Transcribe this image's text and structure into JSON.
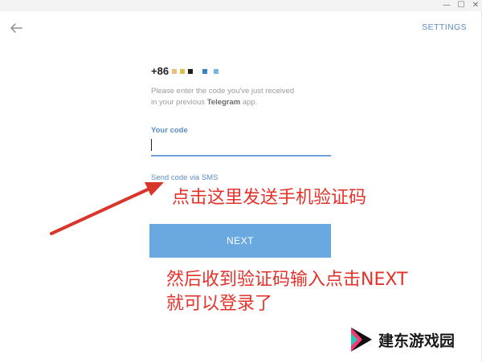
{
  "window": {
    "controls": {
      "minimize": "—",
      "maximize": "☐",
      "close": "✕"
    }
  },
  "header": {
    "back_icon": "arrow-left-icon",
    "settings_label": "SETTINGS"
  },
  "phone": {
    "prefix": "+86",
    "redaction_colors": [
      "#e8c07a",
      "#d8c24c",
      "#1f1f1f",
      "#3b82c4",
      "#78b4e0"
    ]
  },
  "instructions": {
    "line1": "Please enter the code you've just received",
    "line2_pre": "in your previous ",
    "line2_bold": "Telegram",
    "line2_post": " app."
  },
  "code_field": {
    "label": "Your code",
    "value": ""
  },
  "sms_link": "Send code via SMS",
  "next_button": "NEXT",
  "annotations": {
    "note1": "点击这里发送手机验证码",
    "note2_line1": "然后收到验证码输入点击NEXT",
    "note2_line2": "就可以登录了"
  },
  "watermark": "建东游戏园",
  "colors": {
    "accent": "#5b8cc3",
    "button": "#6aa8e0",
    "annotation": "#e4322a"
  }
}
